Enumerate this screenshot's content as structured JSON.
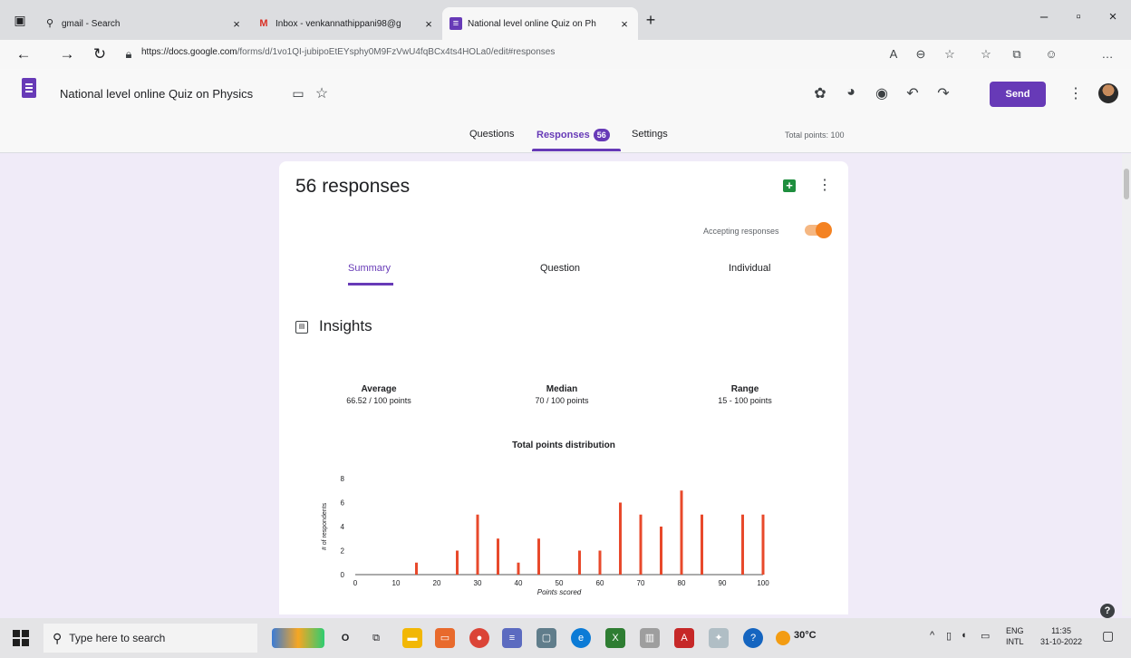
{
  "browser": {
    "tabs": [
      {
        "label": "gmail - Search",
        "icon": "search-icon"
      },
      {
        "label": "Inbox - venkannathippani98@g",
        "icon": "gmail-icon"
      },
      {
        "label": "National level online Quiz on Ph",
        "icon": "forms-icon"
      }
    ],
    "new_tab": "+",
    "url_host": "https://docs.google.com",
    "url_path": "/forms/d/1vo1QI-jubipoEtEYsphy0M9FzVwU4fqBCx4ts4HOLa0/edit#responses"
  },
  "form": {
    "title": "National level online Quiz on Physics",
    "send_label": "Send",
    "tabs": {
      "questions": "Questions",
      "responses": "Responses",
      "responses_count": "56",
      "settings": "Settings"
    },
    "total_points": "Total points: 100"
  },
  "responses": {
    "count_label": "56 responses",
    "accepting_label": "Accepting responses",
    "accepting": true,
    "subtabs": {
      "summary": "Summary",
      "question": "Question",
      "individual": "Individual"
    },
    "insights_title": "Insights",
    "stats": {
      "average_label": "Average",
      "average_value": "66.52 / 100 points",
      "median_label": "Median",
      "median_value": "70 / 100 points",
      "range_label": "Range",
      "range_value": "15 - 100 points"
    }
  },
  "chart_data": {
    "type": "bar",
    "title": "Total points distribution",
    "xlabel": "Points scored",
    "ylabel": "# of respondents",
    "x": [
      15,
      25,
      30,
      35,
      40,
      45,
      55,
      60,
      65,
      70,
      75,
      80,
      85,
      95,
      100
    ],
    "values": [
      1,
      2,
      5,
      3,
      1,
      3,
      2,
      2,
      6,
      5,
      4,
      7,
      5,
      5,
      5
    ],
    "xlim": [
      0,
      100
    ],
    "ylim": [
      0,
      8
    ],
    "xticks": [
      0,
      10,
      20,
      30,
      40,
      50,
      60,
      70,
      80,
      90,
      100
    ],
    "yticks": [
      0,
      2,
      4,
      6,
      8
    ],
    "bar_color": "#e8492b",
    "grid": false
  },
  "taskbar": {
    "search_placeholder": "Type here to search",
    "temperature": "30°C",
    "lang_top": "ENG",
    "lang_bottom": "INTL",
    "time": "11:35",
    "date": "31-10-2022"
  },
  "colors": {
    "accent": "#673ab7",
    "toggle": "#f48222",
    "sheets": "#1e8e3e"
  }
}
